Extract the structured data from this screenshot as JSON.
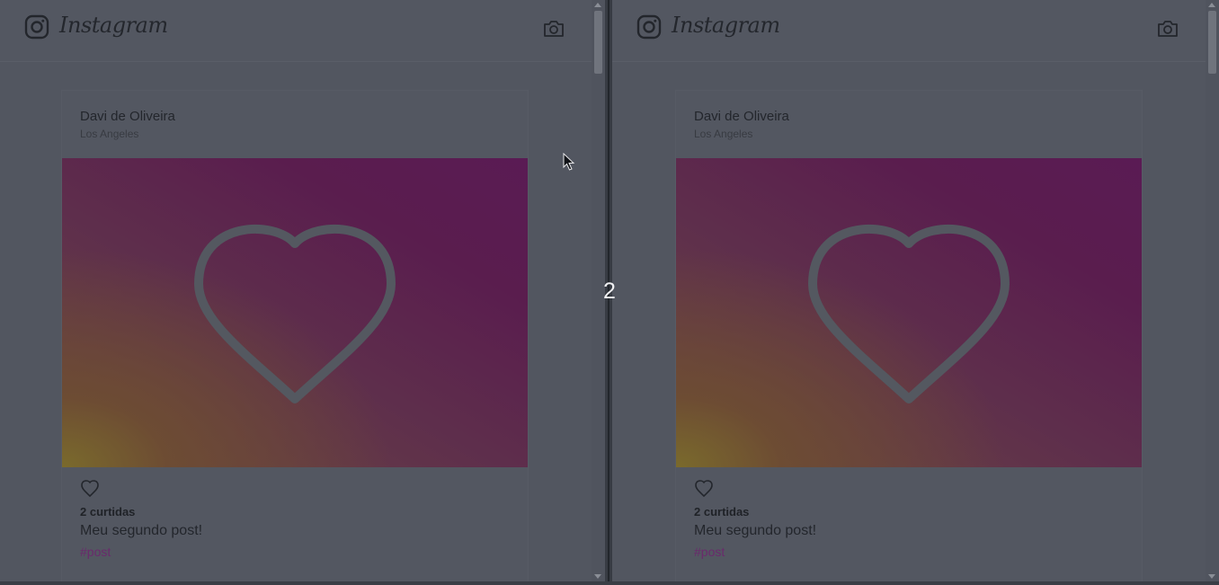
{
  "panes": [
    {
      "header": {
        "logo_text": "Instagram"
      },
      "post": {
        "author": "Davi de Oliveira",
        "location": "Los Angeles",
        "likes": "2 curtidas",
        "caption": "Meu segundo post!",
        "hashtag": "#post"
      }
    },
    {
      "header": {
        "logo_text": "Instagram"
      },
      "post": {
        "author": "Davi de Oliveira",
        "location": "Los Angeles",
        "likes": "2 curtidas",
        "caption": "Meu segundo post!",
        "hashtag": "#post"
      }
    }
  ],
  "step_number": "2",
  "icons": {
    "brand": "instagram-glyph-icon",
    "camera": "camera-icon",
    "like": "heart-outline-icon",
    "photo": "heart-image-icon",
    "pointer": "mouse-cursor-icon"
  },
  "colors": {
    "overlay_background": "#525660",
    "hashtag": "#6a2a6c",
    "photo_gradient": [
      "#7a6a2c",
      "#6a4642",
      "#5a1d4e"
    ]
  }
}
